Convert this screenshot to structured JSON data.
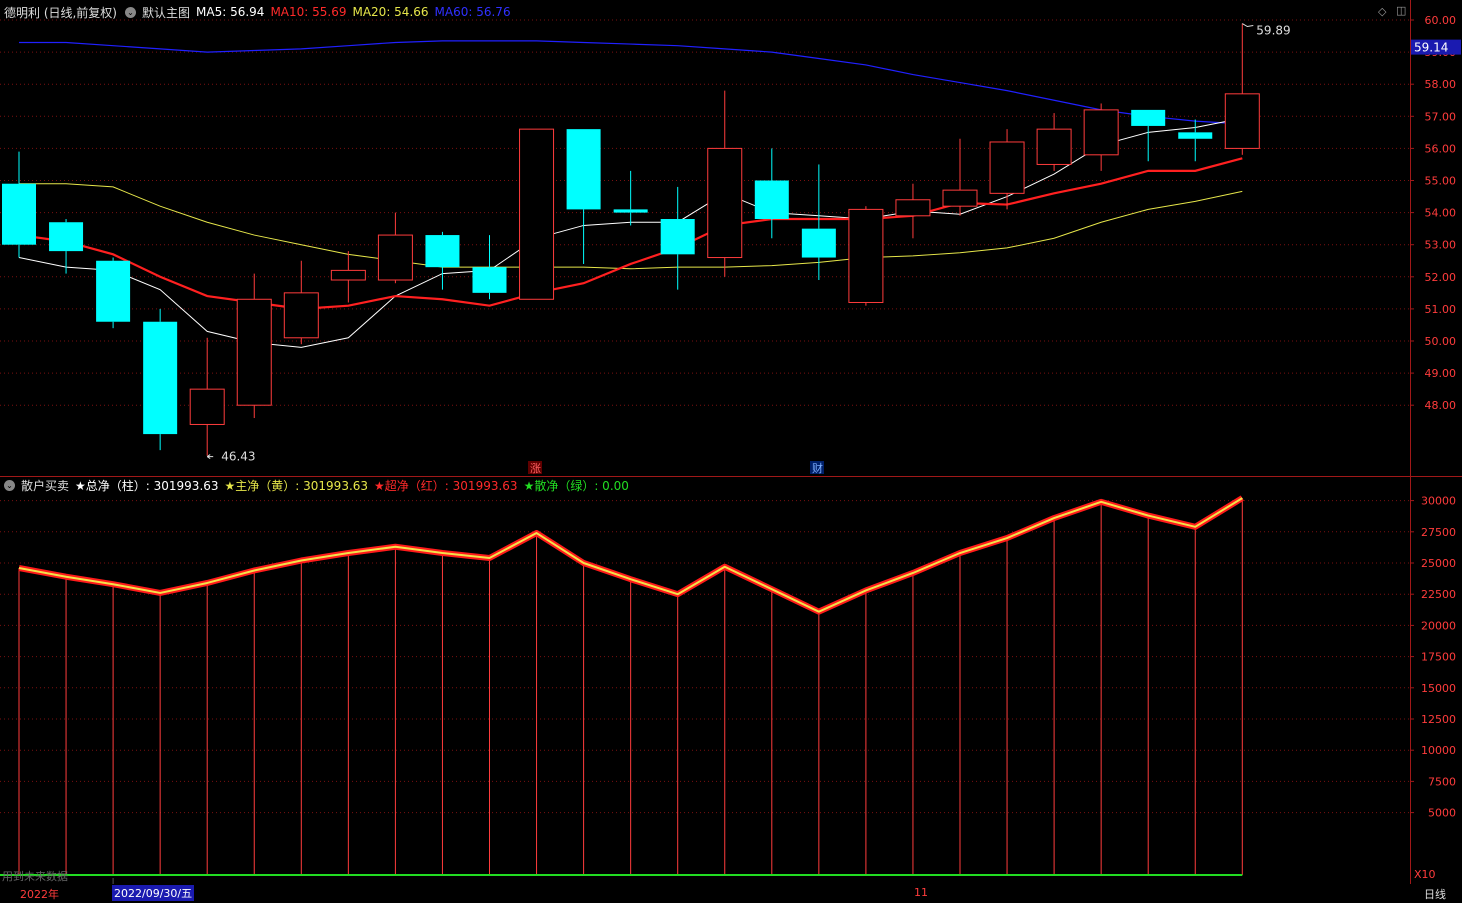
{
  "header": {
    "stock_title": "德明利 (日线,前复权)",
    "main_chart": "默认主图",
    "ma5": "MA5: 56.94",
    "ma10": "MA10: 55.69",
    "ma20": "MA20: 54.66",
    "ma60": "MA60: 56.76"
  },
  "indicator": {
    "name": "散户买卖",
    "total": "★总净（柱）: 301993.63",
    "main": "★主净（黄）: 301993.63",
    "super": "★超净（红）: 301993.63",
    "retail": "★散净（绿）: 0.00"
  },
  "markers": {
    "up": "涨",
    "fin": "财",
    "high": "59.89",
    "low": "46.43",
    "price_tag": "59.14"
  },
  "footer": {
    "year": "2022年",
    "date": "2022/09/30/五",
    "month": "11",
    "notice": "用到未来数据",
    "period": "日线",
    "multiplier": "X10"
  },
  "colors": {
    "up": "#ff3c3c",
    "down": "#00ffff",
    "ma5": "#ffffff",
    "ma10": "#ff2020",
    "ma20": "#e6e64a",
    "ma60": "#2020ff",
    "grid": "#7a1010"
  },
  "chart_data": [
    {
      "type": "candlestick",
      "price_axis": {
        "ticks": [
          "60.00",
          "59.00",
          "58.00",
          "57.00",
          "56.00",
          "55.00",
          "54.00",
          "53.00",
          "52.00",
          "51.00",
          "50.00",
          "49.00",
          "48.00"
        ],
        "ylim": [
          46.0,
          60.6
        ]
      },
      "candles": [
        {
          "o": 54.9,
          "c": 53.0,
          "h": 55.9,
          "l": 52.6
        },
        {
          "o": 53.7,
          "c": 52.8,
          "h": 53.8,
          "l": 52.1
        },
        {
          "o": 52.5,
          "c": 50.6,
          "h": 52.6,
          "l": 50.4
        },
        {
          "o": 50.6,
          "c": 47.1,
          "h": 51.0,
          "l": 46.6
        },
        {
          "o": 47.4,
          "c": 48.5,
          "h": 50.1,
          "l": 46.43
        },
        {
          "o": 48.0,
          "c": 51.3,
          "h": 52.1,
          "l": 47.6
        },
        {
          "o": 50.1,
          "c": 51.5,
          "h": 52.5,
          "l": 49.9
        },
        {
          "o": 51.9,
          "c": 52.2,
          "h": 52.8,
          "l": 51.2
        },
        {
          "o": 51.9,
          "c": 53.3,
          "h": 54.0,
          "l": 51.8
        },
        {
          "o": 53.3,
          "c": 52.3,
          "h": 53.4,
          "l": 51.6
        },
        {
          "o": 52.3,
          "c": 51.5,
          "h": 53.3,
          "l": 51.3
        },
        {
          "o": 51.3,
          "c": 56.6,
          "h": 56.6,
          "l": 51.3
        },
        {
          "o": 56.6,
          "c": 54.1,
          "h": 56.6,
          "l": 52.4
        },
        {
          "o": 54.1,
          "c": 54.0,
          "h": 55.3,
          "l": 53.6
        },
        {
          "o": 53.8,
          "c": 52.7,
          "h": 54.8,
          "l": 51.6
        },
        {
          "o": 52.6,
          "c": 56.0,
          "h": 57.8,
          "l": 52.0
        },
        {
          "o": 55.0,
          "c": 53.8,
          "h": 56.0,
          "l": 53.2
        },
        {
          "o": 53.5,
          "c": 52.6,
          "h": 55.5,
          "l": 51.9
        },
        {
          "o": 51.2,
          "c": 54.1,
          "h": 54.2,
          "l": 51.1
        },
        {
          "o": 53.9,
          "c": 54.4,
          "h": 54.9,
          "l": 53.2
        },
        {
          "o": 54.2,
          "c": 54.7,
          "h": 56.3,
          "l": 53.9
        },
        {
          "o": 54.6,
          "c": 56.2,
          "h": 56.6,
          "l": 54.1
        },
        {
          "o": 55.5,
          "c": 56.6,
          "h": 57.1,
          "l": 55.3
        },
        {
          "o": 55.8,
          "c": 57.2,
          "h": 57.4,
          "l": 55.3
        },
        {
          "o": 57.2,
          "c": 56.7,
          "h": 57.2,
          "l": 55.6
        },
        {
          "o": 56.5,
          "c": 56.3,
          "h": 56.9,
          "l": 55.6
        },
        {
          "o": 56.0,
          "c": 57.7,
          "h": 59.89,
          "l": 55.8
        }
      ],
      "ma5": [
        52.6,
        52.3,
        52.2,
        51.6,
        50.3,
        49.95,
        49.8,
        50.1,
        51.4,
        52.1,
        52.2,
        53.2,
        53.6,
        53.7,
        53.7,
        54.6,
        54.0,
        53.9,
        53.8,
        54.05,
        53.95,
        54.5,
        55.2,
        56.1,
        56.5,
        56.65,
        56.94
      ],
      "ma10": [
        53.3,
        53.1,
        52.7,
        52.0,
        51.4,
        51.2,
        51.0,
        51.1,
        51.4,
        51.3,
        51.1,
        51.5,
        51.8,
        52.4,
        52.9,
        53.6,
        53.8,
        53.8,
        53.8,
        53.9,
        54.3,
        54.25,
        54.6,
        54.9,
        55.3,
        55.3,
        55.69
      ],
      "ma20": [
        54.9,
        54.9,
        54.8,
        54.2,
        53.7,
        53.3,
        53.0,
        52.7,
        52.5,
        52.3,
        52.3,
        52.3,
        52.3,
        52.25,
        52.3,
        52.3,
        52.35,
        52.45,
        52.6,
        52.65,
        52.75,
        52.9,
        53.2,
        53.7,
        54.1,
        54.35,
        54.66
      ],
      "ma60": [
        59.3,
        59.3,
        59.2,
        59.1,
        59.0,
        59.05,
        59.1,
        59.2,
        59.3,
        59.35,
        59.35,
        59.35,
        59.3,
        59.25,
        59.2,
        59.1,
        59.0,
        58.8,
        58.6,
        58.3,
        58.05,
        57.8,
        57.5,
        57.2,
        57.0,
        56.85,
        56.76
      ]
    },
    {
      "type": "line",
      "title": "散户买卖",
      "value_axis": {
        "ticks": [
          "30000",
          "27500",
          "25000",
          "22500",
          "20000",
          "17500",
          "15000",
          "12500",
          "10000",
          "7500",
          "5000"
        ],
        "ylim": [
          0,
          31000
        ]
      },
      "values": [
        24600,
        23900,
        23300,
        22600,
        23400,
        24400,
        25200,
        25800,
        26300,
        25800,
        25400,
        27400,
        25000,
        23700,
        22500,
        24700,
        22900,
        21100,
        22800,
        24200,
        25800,
        27000,
        28600,
        29900,
        28800,
        27900,
        30200
      ]
    }
  ]
}
